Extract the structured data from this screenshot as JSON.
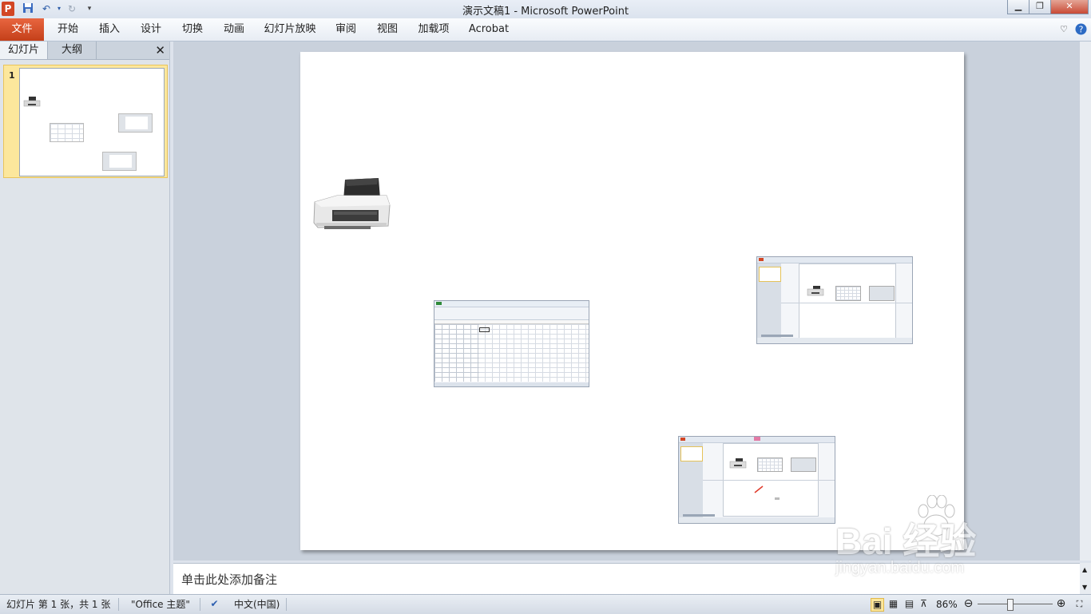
{
  "window": {
    "title": "演示文稿1  -  Microsoft PowerPoint",
    "app_logo": "P",
    "controls": [
      "minimize-icon",
      "restore-icon",
      "close-icon"
    ]
  },
  "quick_access": [
    "save-icon",
    "undo-icon",
    "redo-icon",
    "customize-icon"
  ],
  "ribbon": {
    "tabs": [
      "文件",
      "开始",
      "插入",
      "设计",
      "切换",
      "动画",
      "幻灯片放映",
      "审阅",
      "视图",
      "加载项",
      "Acrobat"
    ],
    "active_tab": "文件"
  },
  "left_pane": {
    "tabs": [
      "幻灯片",
      "大纲"
    ],
    "active_tab": "幻灯片",
    "slide_number": "1"
  },
  "notes": {
    "placeholder": "单击此处添加备注"
  },
  "status_bar": {
    "slide_info": "幻灯片 第 1 张，共 1 张",
    "theme": "\"Office 主题\"",
    "language": "中文(中国)",
    "zoom": "86%",
    "zoom_level": 0.43
  },
  "watermark": {
    "brand": "Bai  经验",
    "url": "jingyan.baidu.com"
  }
}
